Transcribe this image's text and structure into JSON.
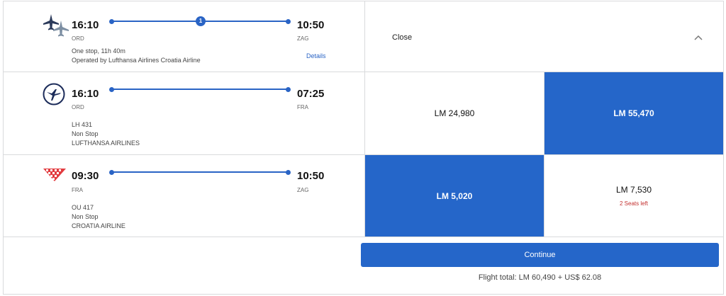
{
  "segments": [
    {
      "logo": "plane-pair-icon",
      "depart_time": "16:10",
      "arrive_time": "10:50",
      "from": "ORD",
      "to": "ZAG",
      "stops_badge": "1",
      "lines": [
        "One stop, 11h 40m",
        "Operated by Lufthansa Airlines Croatia Airline"
      ],
      "details_label": "Details"
    },
    {
      "logo": "lufthansa-crane-icon",
      "depart_time": "16:10",
      "arrive_time": "07:25",
      "from": "ORD",
      "to": "FRA",
      "lines": [
        "LH 431",
        "Non Stop",
        "LUFTHANSA AIRLINES"
      ]
    },
    {
      "logo": "croatia-airlines-icon",
      "depart_time": "09:30",
      "arrive_time": "10:50",
      "from": "FRA",
      "to": "ZAG",
      "lines": [
        "OU 417",
        "Non Stop",
        "CROATIA AIRLINE"
      ]
    }
  ],
  "header": {
    "close_label": "Close"
  },
  "fares": {
    "row1": [
      {
        "price": "LM 24,980",
        "selected": false
      },
      {
        "price": "LM 55,470",
        "selected": true
      }
    ],
    "row2": [
      {
        "price": "LM 5,020",
        "selected": true
      },
      {
        "price": "LM 7,530",
        "selected": false,
        "seats": "2 Seats left"
      }
    ]
  },
  "footer": {
    "continue_label": "Continue",
    "total": "Flight total: LM 60,490 + US$ 62.08"
  },
  "colors": {
    "accent": "#2566c9",
    "warning": "#c3302f",
    "border": "#d9dadc"
  }
}
